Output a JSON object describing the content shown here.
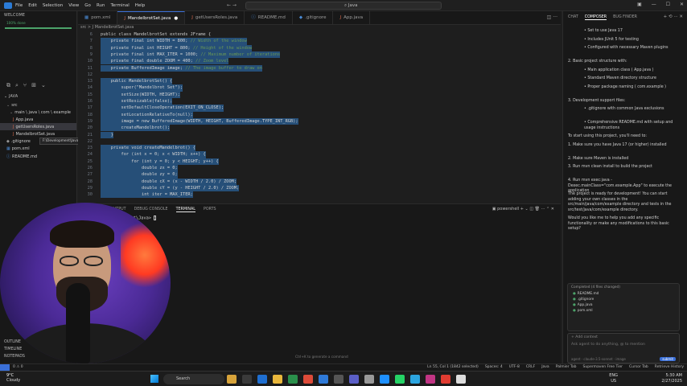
{
  "titlebar": {
    "menu": [
      "File",
      "Edit",
      "Selection",
      "View",
      "Go",
      "Run",
      "Terminal",
      "Help"
    ],
    "search": "Java"
  },
  "sidebar": {
    "welcome_head": "WELCOME",
    "progress_text": "100% done",
    "progress_fraction": 1.0,
    "explorer_head": "JAVA",
    "tree": [
      {
        "label": "src",
        "kind": "folder",
        "indent": 1
      },
      {
        "label": "main \\ java \\ com \\ example",
        "kind": "folder",
        "indent": 2
      },
      {
        "label": "App.java",
        "kind": "java",
        "indent": 3
      },
      {
        "label": "getUsersRoles.java",
        "kind": "java",
        "indent": 3
      },
      {
        "label": "MandelbrotSet.java",
        "kind": "java",
        "indent": 3
      },
      {
        "label": ".gitignore",
        "kind": "git",
        "indent": 1
      },
      {
        "label": "pom.xml",
        "kind": "maven",
        "indent": 1
      },
      {
        "label": "README.md",
        "kind": "md",
        "indent": 1
      }
    ],
    "tooltip": "F:\\Development\\Java\\src\\getUsersRoles.java",
    "bottom_sections": [
      "OUTLINE",
      "TIMELINE",
      "NOTEPADS"
    ]
  },
  "editor": {
    "tabs": [
      {
        "label": "pom.xml",
        "active": false,
        "modified": false
      },
      {
        "label": "MandelbrotSet.java",
        "active": true,
        "modified": true
      },
      {
        "label": "getUsersRoles.java",
        "active": false,
        "modified": false
      },
      {
        "label": "README.md",
        "active": false,
        "modified": false
      },
      {
        "label": ".gitignore",
        "active": false,
        "modified": false
      },
      {
        "label": "App.java",
        "active": false,
        "modified": false
      }
    ],
    "breadcrumb": "src > J MandelbrotSet.java",
    "lines": [
      {
        "n": "6",
        "code": "public class MandelbrotSet extends JFrame {",
        "comment": "",
        "selected": false
      },
      {
        "n": "7",
        "code": "    private final int WIDTH = 800;",
        "comment": " // Width of the window",
        "selected": true
      },
      {
        "n": "8",
        "code": "    private final int HEIGHT = 800;",
        "comment": " // Height of the window",
        "selected": true
      },
      {
        "n": "9",
        "code": "    private final int MAX_ITER = 1000;",
        "comment": " // Maximum number of iterations",
        "selected": true
      },
      {
        "n": "10",
        "code": "    private final double ZOOM = 400;",
        "comment": " // Zoom level",
        "selected": true
      },
      {
        "n": "11",
        "code": "    private BufferedImage image;",
        "comment": " // The image buffer to draw on",
        "selected": true
      },
      {
        "n": "12",
        "code": "",
        "comment": "",
        "selected": true
      },
      {
        "n": "13",
        "code": "    public MandelbrotSet() {",
        "comment": "",
        "selected": true
      },
      {
        "n": "14",
        "code": "        super(\"Mandelbrot Set\");",
        "comment": "",
        "selected": true
      },
      {
        "n": "15",
        "code": "        setSize(WIDTH, HEIGHT);",
        "comment": "",
        "selected": true
      },
      {
        "n": "16",
        "code": "        setResizable(false);",
        "comment": "",
        "selected": true
      },
      {
        "n": "17",
        "code": "        setDefaultCloseOperation(EXIT_ON_CLOSE);",
        "comment": "",
        "selected": true
      },
      {
        "n": "18",
        "code": "        setLocationRelativeTo(null);",
        "comment": "",
        "selected": true
      },
      {
        "n": "19",
        "code": "        image = new BufferedImage(WIDTH, HEIGHT, BufferedImage.TYPE_INT_RGB);",
        "comment": "",
        "selected": true
      },
      {
        "n": "20",
        "code": "        createMandelbrot();",
        "comment": "",
        "selected": true
      },
      {
        "n": "21",
        "code": "    }",
        "comment": "",
        "selected": true
      },
      {
        "n": "22",
        "code": "",
        "comment": "",
        "selected": true
      },
      {
        "n": "23",
        "code": "    private void createMandelbrot() {",
        "comment": "",
        "selected": true
      },
      {
        "n": "24",
        "code": "        for (int x = 0; x < WIDTH; x++) {",
        "comment": "",
        "selected": true
      },
      {
        "n": "25",
        "code": "            for (int y = 0; y < HEIGHT; y++) {",
        "comment": "",
        "selected": true
      },
      {
        "n": "26",
        "code": "                double zx = 0;",
        "comment": "",
        "selected": true
      },
      {
        "n": "27",
        "code": "                double zy = 0;",
        "comment": "",
        "selected": true
      },
      {
        "n": "28",
        "code": "                double cX = (x - WIDTH / 2.0) / ZOOM;",
        "comment": "",
        "selected": true
      },
      {
        "n": "29",
        "code": "                double cY = (y - HEIGHT / 2.0) / ZOOM;",
        "comment": "",
        "selected": true
      },
      {
        "n": "30",
        "code": "                int iter = MAX_ITER;",
        "comment": "",
        "selected": true
      }
    ]
  },
  "panel": {
    "tabs": [
      "OUTPUT",
      "DEBUG CONSOLE",
      "TERMINAL",
      "PORTS"
    ],
    "active_tab": "TERMINAL",
    "shell": "powershell",
    "prompt": "...lopment\\Java> ",
    "hint": "Ctrl+K to generate a command"
  },
  "chat": {
    "tabs": [
      "CHAT",
      "COMPOSER",
      "BUG FINDER"
    ],
    "active_tab": "COMPOSER",
    "items": [
      {
        "text": "Set to use Java 17",
        "style": "bullet2"
      },
      {
        "text": "Includes JUnit 5 for testing",
        "style": "bullet2"
      },
      {
        "text": "Configured with necessary Maven plugins",
        "style": "bullet2"
      },
      {
        "text": "2. Basic project structure with:",
        "style": "plain"
      },
      {
        "text": "Main application class ( App.java )",
        "style": "bullet2"
      },
      {
        "text": "Standard Maven directory structure",
        "style": "bullet2"
      },
      {
        "text": "Proper package naming ( com.example )",
        "style": "bullet2"
      },
      {
        "text": "3. Development support files:",
        "style": "plain"
      },
      {
        "text": ".gitignore with common Java exclusions",
        "style": "bullet2"
      },
      {
        "text": "Comprehensive README.md with setup and usage instructions",
        "style": "bullet2"
      },
      {
        "text": "To start using this project, you'll need to:",
        "style": "plain"
      },
      {
        "text": "1. Make sure you have Java 17 (or higher) installed",
        "style": "plain"
      },
      {
        "text": "2. Make sure Maven is installed",
        "style": "plain"
      },
      {
        "text": "3. Run mvn clean install to build the project",
        "style": "plain"
      },
      {
        "text": "4. Run mvn exec:java -Dexec.mainClass=\"com.example.App\" to execute the application",
        "style": "plain"
      },
      {
        "text": "The project is ready for development! You can start adding your own classes in the src/main/java/com/example directory and tests in the src/test/java/com/example directory.",
        "style": "plain"
      },
      {
        "text": "Would you like me to help you add any specific functionality or make any modifications to this basic setup?",
        "style": "plain"
      }
    ],
    "changes_head": "Completed (4 files changed)",
    "changed_files": [
      "README.md",
      ".gitignore",
      "App.java",
      "pom.xml"
    ],
    "context_label": "+ Add context",
    "input_placeholder": "Ask agent to do anything, @ to mention",
    "input_footer": "agent  ·  claude-3.5-sonnet  ·  image",
    "submit_label": "submit"
  },
  "statusbar": {
    "left": "0 ⚠ 0",
    "right": [
      "Ln 55, Col 1 (1842 selected)",
      "Spaces: 4",
      "UTF-8",
      "CRLF",
      "Java",
      "Palmier Tab",
      "Supermaven Free Tier",
      "Cursor Tab",
      "Retrieve History"
    ]
  },
  "taskbar": {
    "temp": "9°C",
    "condition": "Cloudy",
    "search": "Search",
    "lang_top": "ENG",
    "lang_bottom": "US",
    "time": "5:30 AM",
    "date": "2/27/2025"
  }
}
